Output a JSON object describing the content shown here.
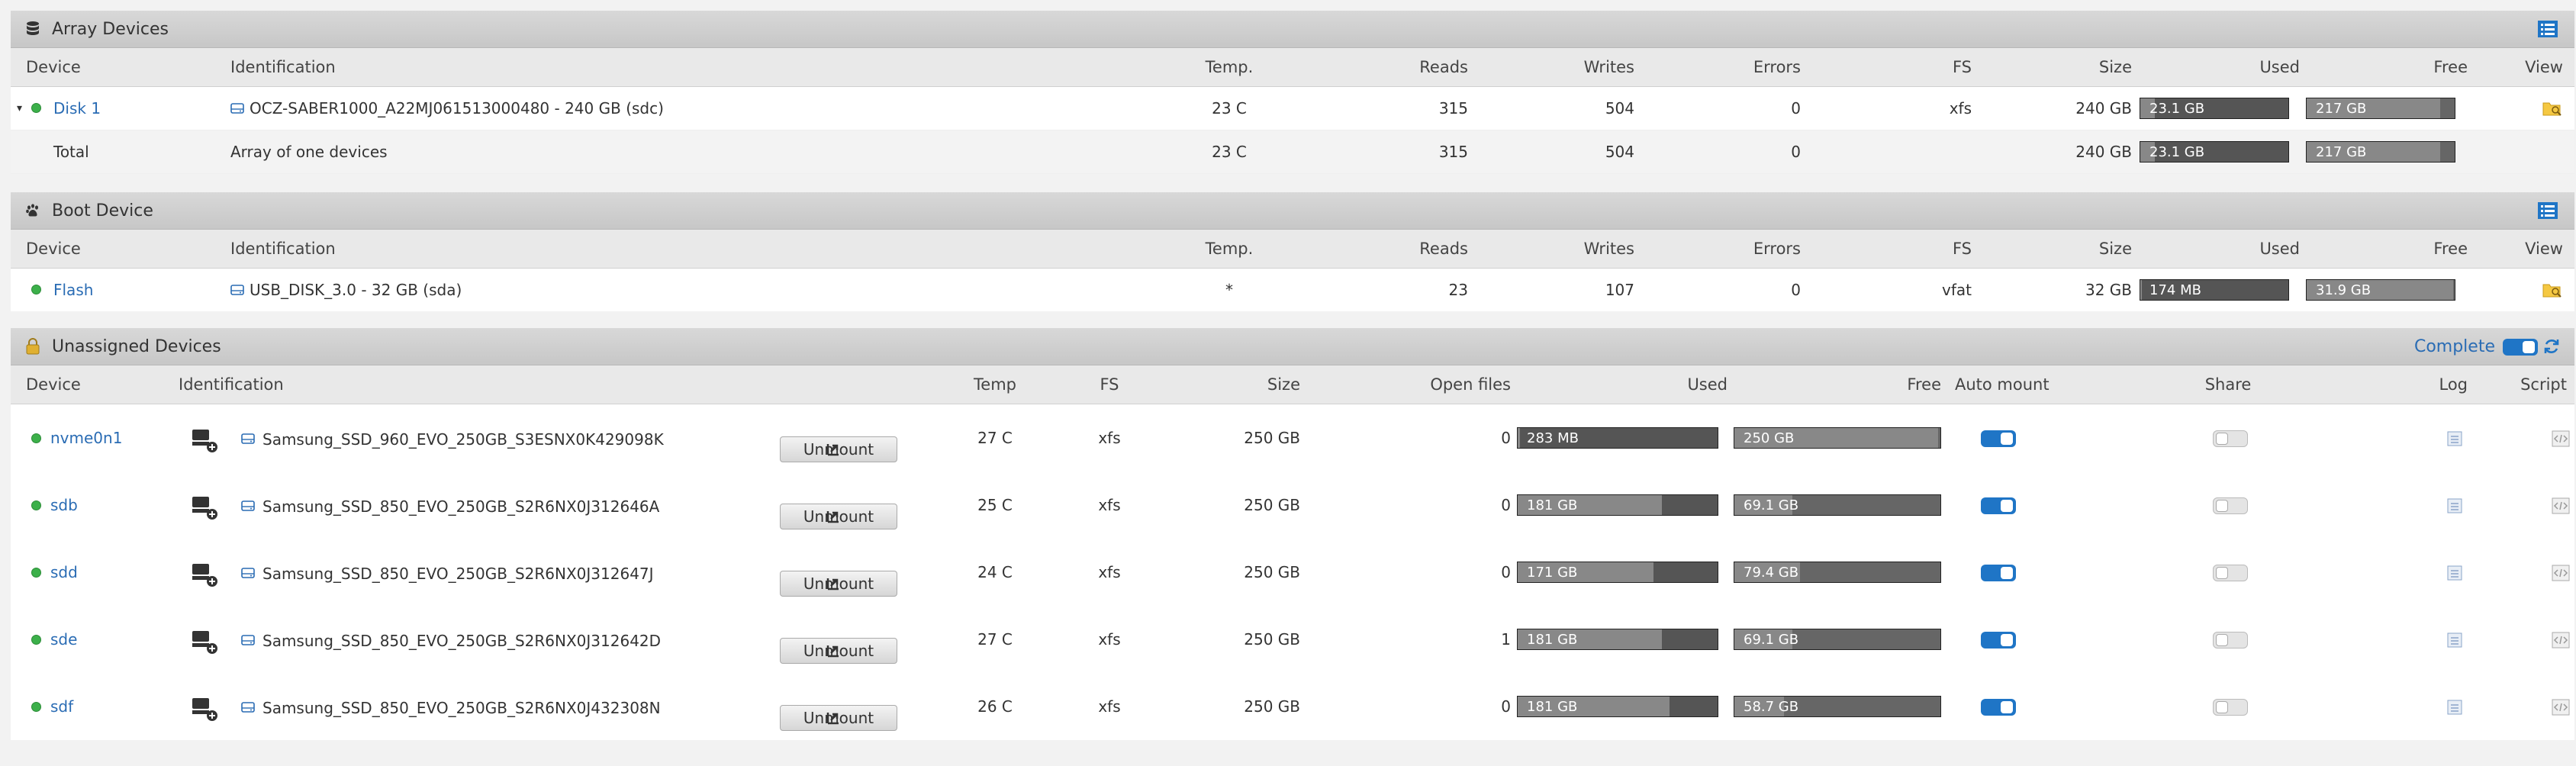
{
  "array": {
    "title": "Array Devices",
    "headers": {
      "device": "Device",
      "identification": "Identification",
      "temp": "Temp.",
      "reads": "Reads",
      "writes": "Writes",
      "errors": "Errors",
      "fs": "FS",
      "size": "Size",
      "used": "Used",
      "free": "Free",
      "view": "View"
    },
    "rows": [
      {
        "device": "Disk 1",
        "identification": "OCZ-SABER1000_A22MJ061513000480 - 240 GB (sdc)",
        "temp": "23 C",
        "reads": "315",
        "writes": "504",
        "errors": "0",
        "fs": "xfs",
        "size": "240 GB",
        "used": "23.1 GB",
        "free": "217 GB",
        "used_fraction": 0.1,
        "free_fraction": 0.9
      }
    ],
    "total": {
      "device": "Total",
      "identification": "Array of one devices",
      "temp": "23 C",
      "reads": "315",
      "writes": "504",
      "errors": "0",
      "size": "240 GB",
      "used": "23.1 GB",
      "free": "217 GB",
      "used_fraction": 0.1,
      "free_fraction": 0.9
    }
  },
  "boot": {
    "title": "Boot Device",
    "headers": {
      "device": "Device",
      "identification": "Identification",
      "temp": "Temp.",
      "reads": "Reads",
      "writes": "Writes",
      "errors": "Errors",
      "fs": "FS",
      "size": "Size",
      "used": "Used",
      "free": "Free",
      "view": "View"
    },
    "rows": [
      {
        "device": "Flash",
        "identification": "USB_DISK_3.0 - 32 GB (sda)",
        "temp": "*",
        "reads": "23",
        "writes": "107",
        "errors": "0",
        "fs": "vfat",
        "size": "32 GB",
        "used": "174 MB",
        "free": "31.9 GB",
        "used_fraction": 0.01,
        "free_fraction": 0.99
      }
    ]
  },
  "unassigned": {
    "title": "Unassigned Devices",
    "complete_label": "Complete",
    "headers": {
      "device": "Device",
      "identification": "Identification",
      "temp": "Temp",
      "fs": "FS",
      "size": "Size",
      "open_files": "Open files",
      "used": "Used",
      "free": "Free",
      "auto_mount": "Auto mount",
      "share": "Share",
      "log": "Log",
      "script": "Script"
    },
    "unmount_label": "Unmount",
    "rows": [
      {
        "device": "nvme0n1",
        "identification": "Samsung_SSD_960_EVO_250GB_S3ESNX0K429098K",
        "temp": "27 C",
        "fs": "xfs",
        "size": "250 GB",
        "open_files": "0",
        "used": "283 MB",
        "free": "250 GB",
        "used_fraction": 0.01,
        "free_fraction": 0.99
      },
      {
        "device": "sdb",
        "identification": "Samsung_SSD_850_EVO_250GB_S2R6NX0J312646A",
        "temp": "25 C",
        "fs": "xfs",
        "size": "250 GB",
        "open_files": "0",
        "used": "181 GB",
        "free": "69.1 GB",
        "used_fraction": 0.72,
        "free_fraction": 0.28
      },
      {
        "device": "sdd",
        "identification": "Samsung_SSD_850_EVO_250GB_S2R6NX0J312647J",
        "temp": "24 C",
        "fs": "xfs",
        "size": "250 GB",
        "open_files": "0",
        "used": "171 GB",
        "free": "79.4 GB",
        "used_fraction": 0.68,
        "free_fraction": 0.32
      },
      {
        "device": "sde",
        "identification": "Samsung_SSD_850_EVO_250GB_S2R6NX0J312642D",
        "temp": "27 C",
        "fs": "xfs",
        "size": "250 GB",
        "open_files": "1",
        "used": "181 GB",
        "free": "69.1 GB",
        "used_fraction": 0.72,
        "free_fraction": 0.28
      },
      {
        "device": "sdf",
        "identification": "Samsung_SSD_850_EVO_250GB_S2R6NX0J432308N",
        "temp": "26 C",
        "fs": "xfs",
        "size": "250 GB",
        "open_files": "0",
        "used": "181 GB",
        "free": "58.7 GB",
        "used_fraction": 0.76,
        "free_fraction": 0.24
      }
    ]
  },
  "colors": {
    "link": "#2a6cb4",
    "status_green": "#3cb04a",
    "toggle_on": "#1f75c6"
  }
}
